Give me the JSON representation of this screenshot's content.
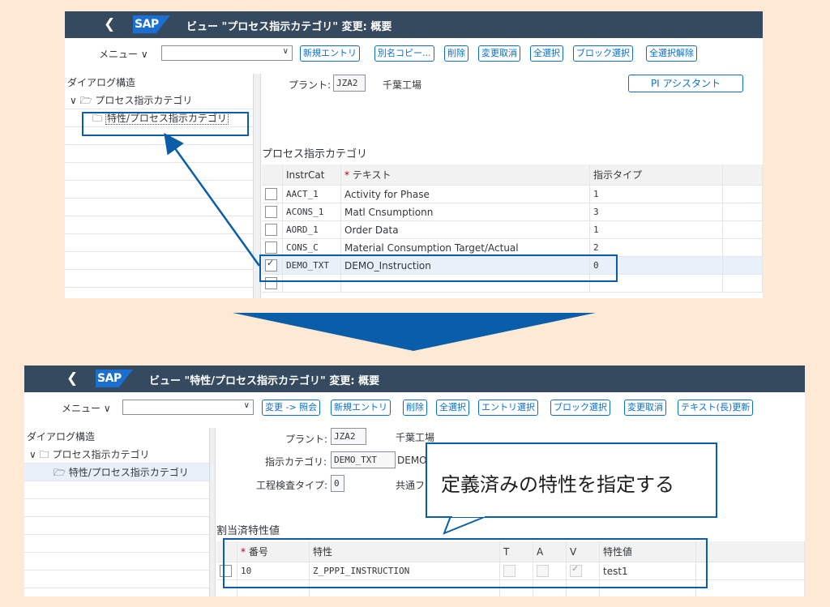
{
  "top": {
    "shell_title": "ビュー \"プロセス指示カテゴリ\" 変更: 概要",
    "logo": "SAP",
    "back_icon": "chevron-left-icon",
    "menu_label": "メニュー",
    "buttons": [
      "新規エントリ",
      "別名コピー...",
      "削除",
      "変更取消",
      "全選択",
      "ブロック選択",
      "全選択解除"
    ],
    "tree_title": "ダイアログ構造",
    "tree_items": [
      "プロセス指示カテゴリ",
      "特性/プロセス指示カテゴリ"
    ],
    "plant_label": "プラント:",
    "plant_value": "JZA2",
    "plant_name": "千葉工場",
    "pi_assistant": "PI アシスタント",
    "section_title": "プロセス指示カテゴリ",
    "table": {
      "headers": [
        "InstrCat",
        "テキスト",
        "指示タイプ"
      ],
      "rows": [
        {
          "checked": false,
          "cat": "AACT_1",
          "text": "Activity for Phase",
          "type": "1"
        },
        {
          "checked": false,
          "cat": "ACONS_1",
          "text": "Matl Cnsumptionn",
          "type": "3"
        },
        {
          "checked": false,
          "cat": "AORD_1",
          "text": "Order Data",
          "type": "1"
        },
        {
          "checked": false,
          "cat": "CONS_C",
          "text": "Material Consumption Target/Actual",
          "type": "2"
        },
        {
          "checked": true,
          "cat": "DEMO_TXT",
          "text": "DEMO_Instruction",
          "type": "0"
        }
      ]
    }
  },
  "bottom": {
    "shell_title": "ビュー \"特性/プロセス指示カテゴリ\" 変更: 概要",
    "logo": "SAP",
    "menu_label": "メニュー",
    "buttons": [
      "変更 -> 照会",
      "新規エントリ",
      "削除",
      "全選択",
      "エントリ選択",
      "ブロック選択",
      "変更取消",
      "テキスト(長)更新"
    ],
    "tree_title": "ダイアログ構造",
    "tree_items": [
      "プロセス指示カテゴリ",
      "特性/プロセス指示カテゴリ"
    ],
    "plant_label": "プラント:",
    "plant_value": "JZA2",
    "plant_name": "千葉工場",
    "category_label": "指示カテゴリ:",
    "category_value": "DEMO_TXT",
    "category_desc": "DEMO",
    "inspection_label": "工程検査タイプ:",
    "inspection_value": "0",
    "common_label": "共通フ",
    "section_title": "割当済特性値",
    "table": {
      "headers": [
        "番号",
        "特性",
        "T",
        "A",
        "V",
        "特性値"
      ],
      "rows": [
        {
          "checked": false,
          "num": "10",
          "char": "Z_PPPI_INSTRUCTION",
          "t": false,
          "a": false,
          "v": true,
          "value": "test1"
        }
      ]
    }
  },
  "callout": "定義済みの特性を指定する",
  "colors": {
    "shell": "#354a5f",
    "accent": "#0a6ed1",
    "highlight": "#0a5ea9",
    "background": "#fde9d4"
  }
}
